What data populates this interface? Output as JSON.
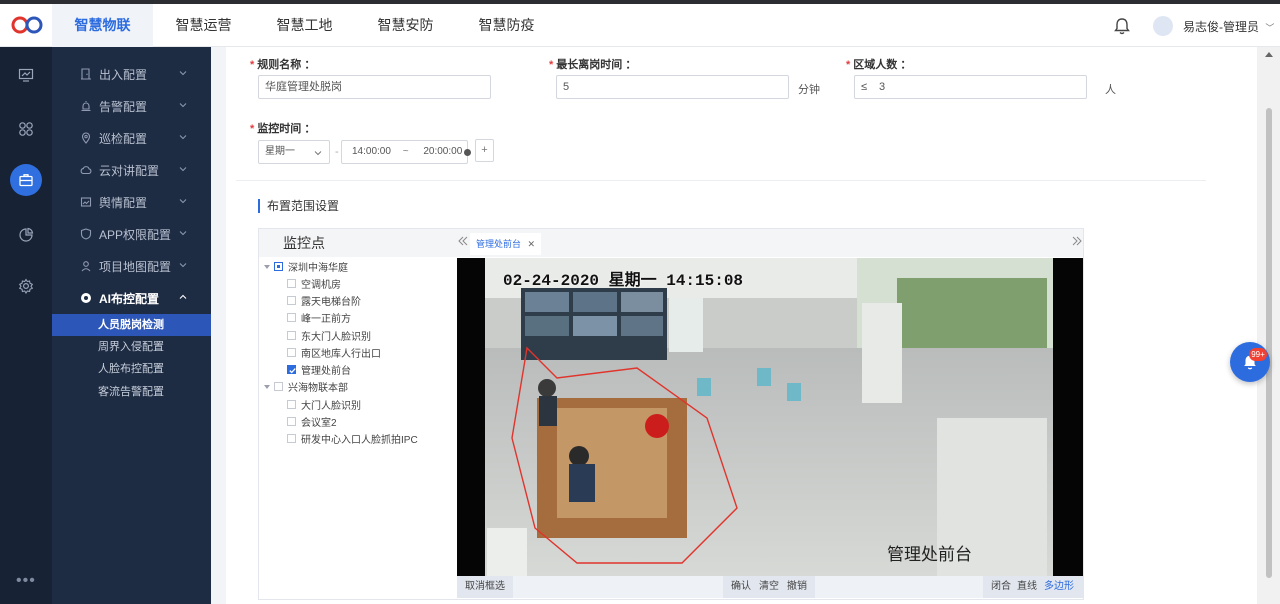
{
  "app": {
    "nav": [
      "智慧物联",
      "智慧运营",
      "智慧工地",
      "智慧安防",
      "智慧防疫"
    ],
    "active_nav": "智慧物联",
    "user": "易志俊-管理员"
  },
  "sidebar": {
    "items": [
      {
        "label": "出入配置",
        "icon": "door-icon"
      },
      {
        "label": "告警配置",
        "icon": "alarm-icon"
      },
      {
        "label": "巡检配置",
        "icon": "location-icon"
      },
      {
        "label": "云对讲配置",
        "icon": "cloud-icon"
      },
      {
        "label": "舆情配置",
        "icon": "image-icon"
      },
      {
        "label": "APP权限配置",
        "icon": "shield-icon"
      },
      {
        "label": "项目地图配置",
        "icon": "map-pin-icon"
      },
      {
        "label": "AI布控配置",
        "icon": "ai-icon"
      }
    ],
    "subitems": [
      "人员脱岗检测",
      "周界入侵配置",
      "人脸布控配置",
      "客流告警配置"
    ],
    "active_sub": "人员脱岗检测"
  },
  "form": {
    "rule_name_label": "规则名称 ：",
    "rule_name_value": "华庭管理处脱岗",
    "max_away_label": "最长离岗时间 ：",
    "max_away_value": "5",
    "max_away_unit": "分钟",
    "area_count_label": "区域人数 ：",
    "area_count_op": "≤",
    "area_count_value": "3",
    "area_count_unit": "人",
    "monitor_time_label": "监控时间 ：",
    "weekday": "星期一",
    "time_start": "14:00:00",
    "time_sep": "~",
    "time_end": "20:00:00",
    "add": "+"
  },
  "section": {
    "title": "布置范围设置"
  },
  "tree": {
    "header": "监控点",
    "groups": [
      {
        "label": "深圳中海华庭",
        "state": "partial",
        "children": [
          {
            "label": "空调机房",
            "checked": false
          },
          {
            "label": "露天电梯台阶",
            "checked": false
          },
          {
            "label": "峰一正前方",
            "checked": false
          },
          {
            "label": "东大门人脸识别",
            "checked": false
          },
          {
            "label": "南区地库人行出口",
            "checked": false
          },
          {
            "label": "管理处前台",
            "checked": true
          }
        ]
      },
      {
        "label": "兴海物联本部",
        "state": "none",
        "children": [
          {
            "label": "大门人脸识别",
            "checked": false
          },
          {
            "label": "会议室2",
            "checked": false
          },
          {
            "label": "研发中心入口人脸抓拍IPC",
            "checked": false
          }
        ]
      }
    ]
  },
  "viewer": {
    "tab": "管理处前台",
    "timestamp": "02-24-2020 星期一 14:15:08",
    "caption": "管理处前台",
    "toolbar": {
      "cancel": "取消框选",
      "confirm": "确认",
      "clear": "清空",
      "undo": "撤销",
      "close": "闭合",
      "line": "直线",
      "polygon": "多边形"
    }
  },
  "float": {
    "badge": "99+"
  },
  "colors": {
    "accent": "#2d6cdf",
    "sidebar": "#1d2b43",
    "rail": "#172235",
    "required": "#e23c3c",
    "zone": "#e0342c"
  }
}
